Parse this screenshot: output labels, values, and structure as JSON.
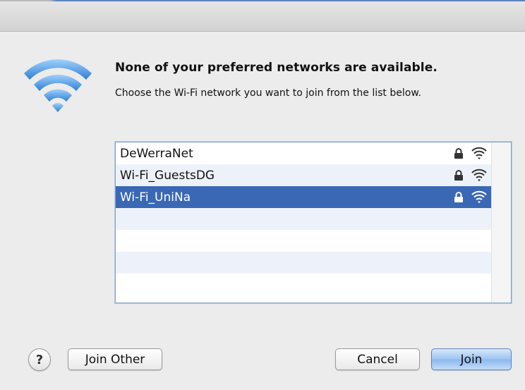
{
  "dialog": {
    "heading": "None of your preferred networks are available.",
    "subheading": "Choose the Wi-Fi network you want to join from the list below."
  },
  "networks": [
    {
      "name": "DeWerraNet",
      "secured": true,
      "selected": false
    },
    {
      "name": "Wi-Fi_GuestsDG",
      "secured": true,
      "selected": false
    },
    {
      "name": "Wi-Fi_UniNa",
      "secured": true,
      "selected": true
    }
  ],
  "buttons": {
    "help": "?",
    "join_other": "Join Other",
    "cancel": "Cancel",
    "join": "Join"
  },
  "icons": {
    "main": "wifi-icon",
    "lock": "lock-icon",
    "signal": "wifi-signal-icon",
    "help": "help-icon"
  },
  "colors": {
    "selection": "#3a68b5",
    "wifi_blue": "#3d8fe0",
    "default_button": "#8ab8ee"
  }
}
